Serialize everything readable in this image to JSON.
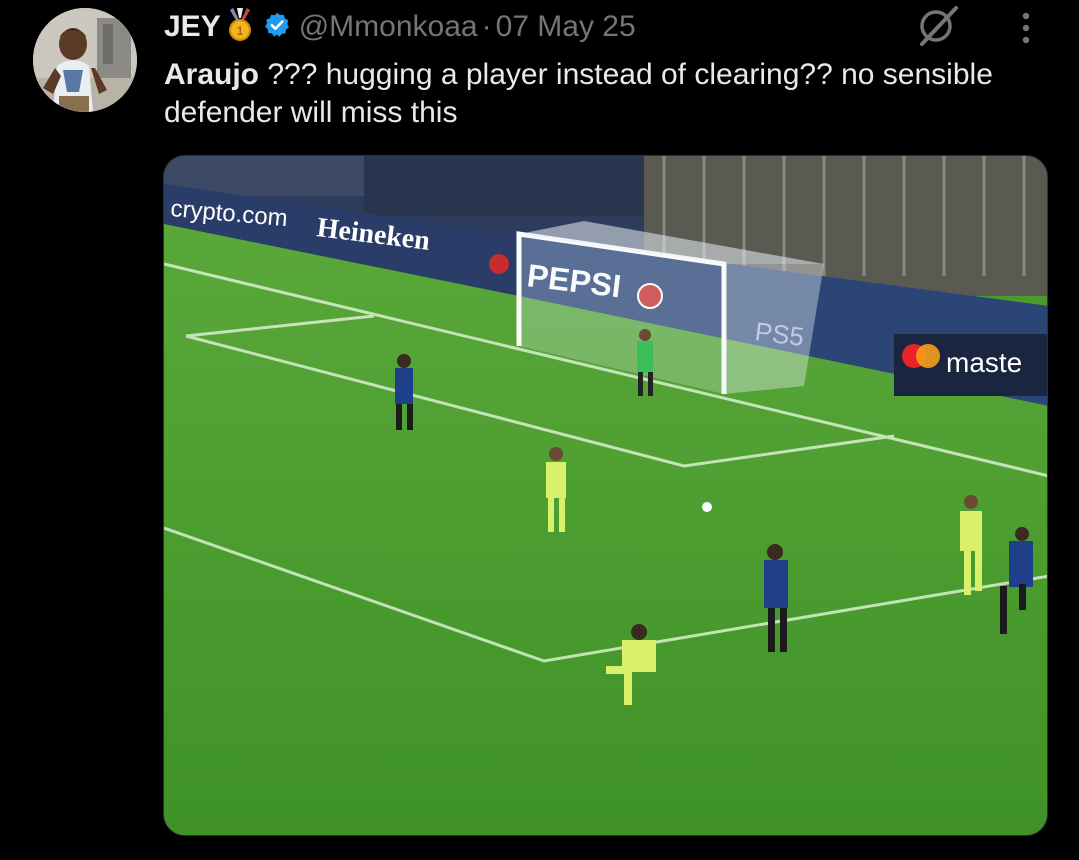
{
  "tweet": {
    "display_name": "JEY",
    "handle": "@Mmonkoaa",
    "separator": "·",
    "date": "07 May 25",
    "text_bold": "Araujo",
    "text_rest": " ??? hugging a player instead of clearing?? no sensible defender will miss this"
  },
  "icons": {
    "avatar": "avatar",
    "medal": "gold-medal-icon",
    "verified": "verified-badge-icon",
    "grok": "grok-icon",
    "more": "more-options-icon"
  },
  "colors": {
    "background": "#000000",
    "text": "#e7e9ea",
    "muted": "#71767b",
    "verified": "#1d9bf0"
  },
  "media": {
    "boards": {
      "crypto": "crypto.com",
      "heineken": "Heineken",
      "pepsi": "PEPSI",
      "ps5": "PS5",
      "mastercard": "maste"
    }
  }
}
